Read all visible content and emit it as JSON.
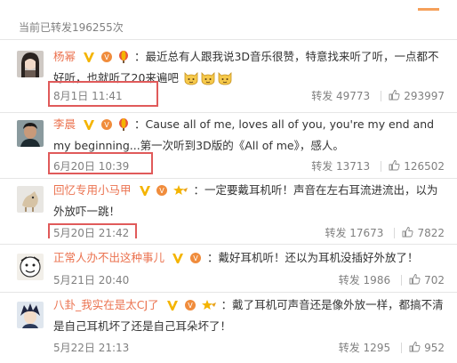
{
  "header": {
    "repost_count_text": "当前已转发196255次"
  },
  "comments": [
    {
      "user": "杨幂",
      "colon": "：",
      "text": "最近总有人跟我说3D音乐很赞，特意找来听了听，一点都不好听，也就听了20来遍吧",
      "emoji": [
        "cat-face-emoji",
        "cat-face-emoji",
        "cat-face-emoji"
      ],
      "time": "8月1日 11:41",
      "repost_label": "转发 49773",
      "likes": "293997",
      "badges": [
        "verified-v-icon",
        "member-badge-icon",
        "balloon-badge-icon"
      ],
      "avatar": "woman-avatar"
    },
    {
      "user": "李晨",
      "colon": "：",
      "text": "Cause all of me, loves all of you, you're my end and my beginning...第一次听到3D版的《All of me》，感人。",
      "time": "6月20日 10:39",
      "repost_label": "转发 13713",
      "likes": "126502",
      "badges": [
        "verified-v-icon",
        "member-badge-icon",
        "balloon-badge-icon"
      ],
      "avatar": "man-avatar"
    },
    {
      "user": "回忆专用小马甲",
      "colon": "：",
      "text": "一定要戴耳机听！声音在左右耳流进流出，以为外放吓一跳！",
      "time": "5月20日 21:42",
      "repost_label": "转发 17673",
      "likes": "7822",
      "badges": [
        "verified-v-icon",
        "member-badge-icon",
        "star-badge-icon"
      ],
      "avatar": "pony-avatar"
    },
    {
      "user": "正常人办不出这种事儿",
      "colon": "：",
      "text": "戴好耳机听！还以为耳机没插好外放了！",
      "time": "5月21日 20:40",
      "repost_label": "转发 1986",
      "likes": "702",
      "badges": [
        "verified-v-icon",
        "member-badge-icon"
      ],
      "avatar": "cartoon-avatar"
    },
    {
      "user": "八卦_我实在是太CJ了",
      "colon": "：",
      "text": "戴了耳机可声音还是像外放一样，都搞不清是自己耳机坏了还是自己耳朵坏了！",
      "time": "5月22日 21:13",
      "repost_label": "转发 1295",
      "likes": "952",
      "badges": [
        "verified-v-icon",
        "member-badge-icon",
        "star-badge-icon"
      ],
      "avatar": "anime-avatar"
    }
  ],
  "colors": {
    "username": "#eb7350",
    "highlight_box": "#e05a5a",
    "meta_text": "#808080"
  }
}
